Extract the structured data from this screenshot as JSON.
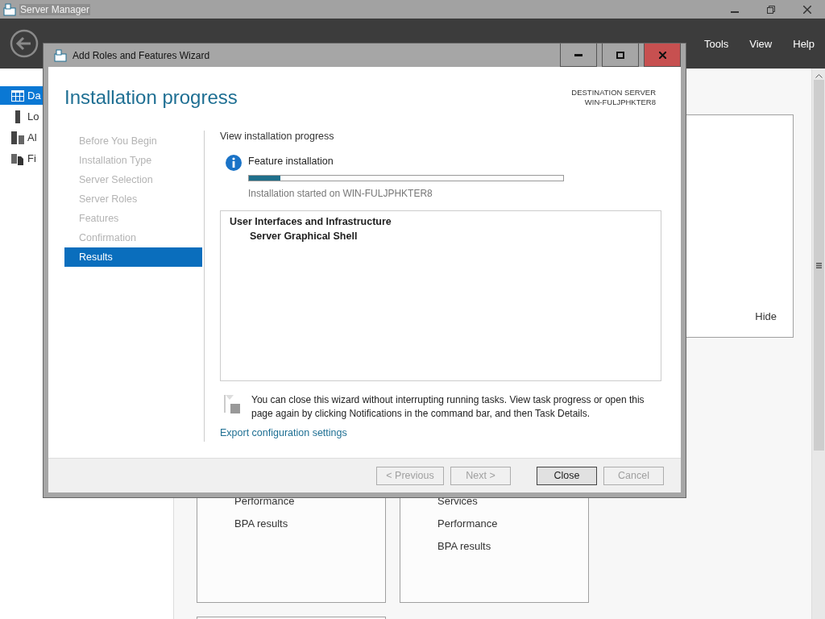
{
  "app": {
    "title": "Server Manager",
    "menu": [
      "Tools",
      "View",
      "Help"
    ]
  },
  "sidebar": {
    "items": [
      {
        "label": "Da",
        "kind": "dashboard",
        "selected": true
      },
      {
        "label": "Lo",
        "kind": "local",
        "selected": false
      },
      {
        "label": "Al",
        "kind": "all",
        "selected": false
      },
      {
        "label": "Fi",
        "kind": "files",
        "selected": false
      }
    ]
  },
  "panel": {
    "hide_link": "Hide"
  },
  "tiles": [
    {
      "items": [
        "Performance",
        "BPA results"
      ]
    },
    {
      "items": [
        "Services",
        "Performance",
        "BPA results"
      ]
    }
  ],
  "wizard": {
    "title": "Add Roles and Features Wizard",
    "heading": "Installation progress",
    "destination_label": "DESTINATION SERVER",
    "destination_server": "WIN-FULJPHKTER8",
    "steps": [
      {
        "label": "Before You Begin",
        "selected": false
      },
      {
        "label": "Installation Type",
        "selected": false
      },
      {
        "label": "Server Selection",
        "selected": false
      },
      {
        "label": "Server Roles",
        "selected": false
      },
      {
        "label": "Features",
        "selected": false
      },
      {
        "label": "Confirmation",
        "selected": false
      },
      {
        "label": "Results",
        "selected": true
      }
    ],
    "section_title": "View installation progress",
    "status_title": "Feature installation",
    "progress": {
      "level": 0.1
    },
    "status_note": "Installation started on WIN-FULJPHKTER8",
    "tree": [
      {
        "label": "User Interfaces and Infrastructure",
        "children": [
          {
            "label": "Server Graphical Shell"
          }
        ]
      }
    ],
    "notice": "You can close this wizard without interrupting running tasks. View task progress or open this page again by clicking Notifications in the command bar, and then Task Details.",
    "export_link": "Export configuration settings",
    "buttons": [
      {
        "label": "< Previous",
        "disabled": true,
        "focused": false
      },
      {
        "label": "Next >",
        "disabled": true,
        "focused": false
      },
      {
        "label": "Close",
        "disabled": false,
        "focused": true
      },
      {
        "label": "Cancel",
        "disabled": true,
        "focused": false
      }
    ]
  }
}
